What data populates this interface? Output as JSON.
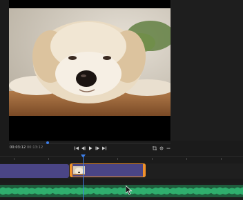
{
  "preview": {
    "media": "dog-photo",
    "time_current": "00:03",
    "time_current_frames": ":12",
    "time_duration": "00:13:12"
  },
  "transport": {
    "controls": [
      "skip-start-icon",
      "step-back-icon",
      "play-icon",
      "step-forward-icon",
      "skip-end-icon"
    ],
    "right_controls": [
      "crop-icon",
      "settings-icon",
      "more-icon"
    ]
  },
  "timeline": {
    "video_track": {
      "clip_color": "#4a4585",
      "selected_border": "#f0922b"
    },
    "audio_track": {
      "clip_color": "#1f5d3d",
      "wave_color": "#2fae6d"
    },
    "playhead_color": "#3d7ee8"
  }
}
